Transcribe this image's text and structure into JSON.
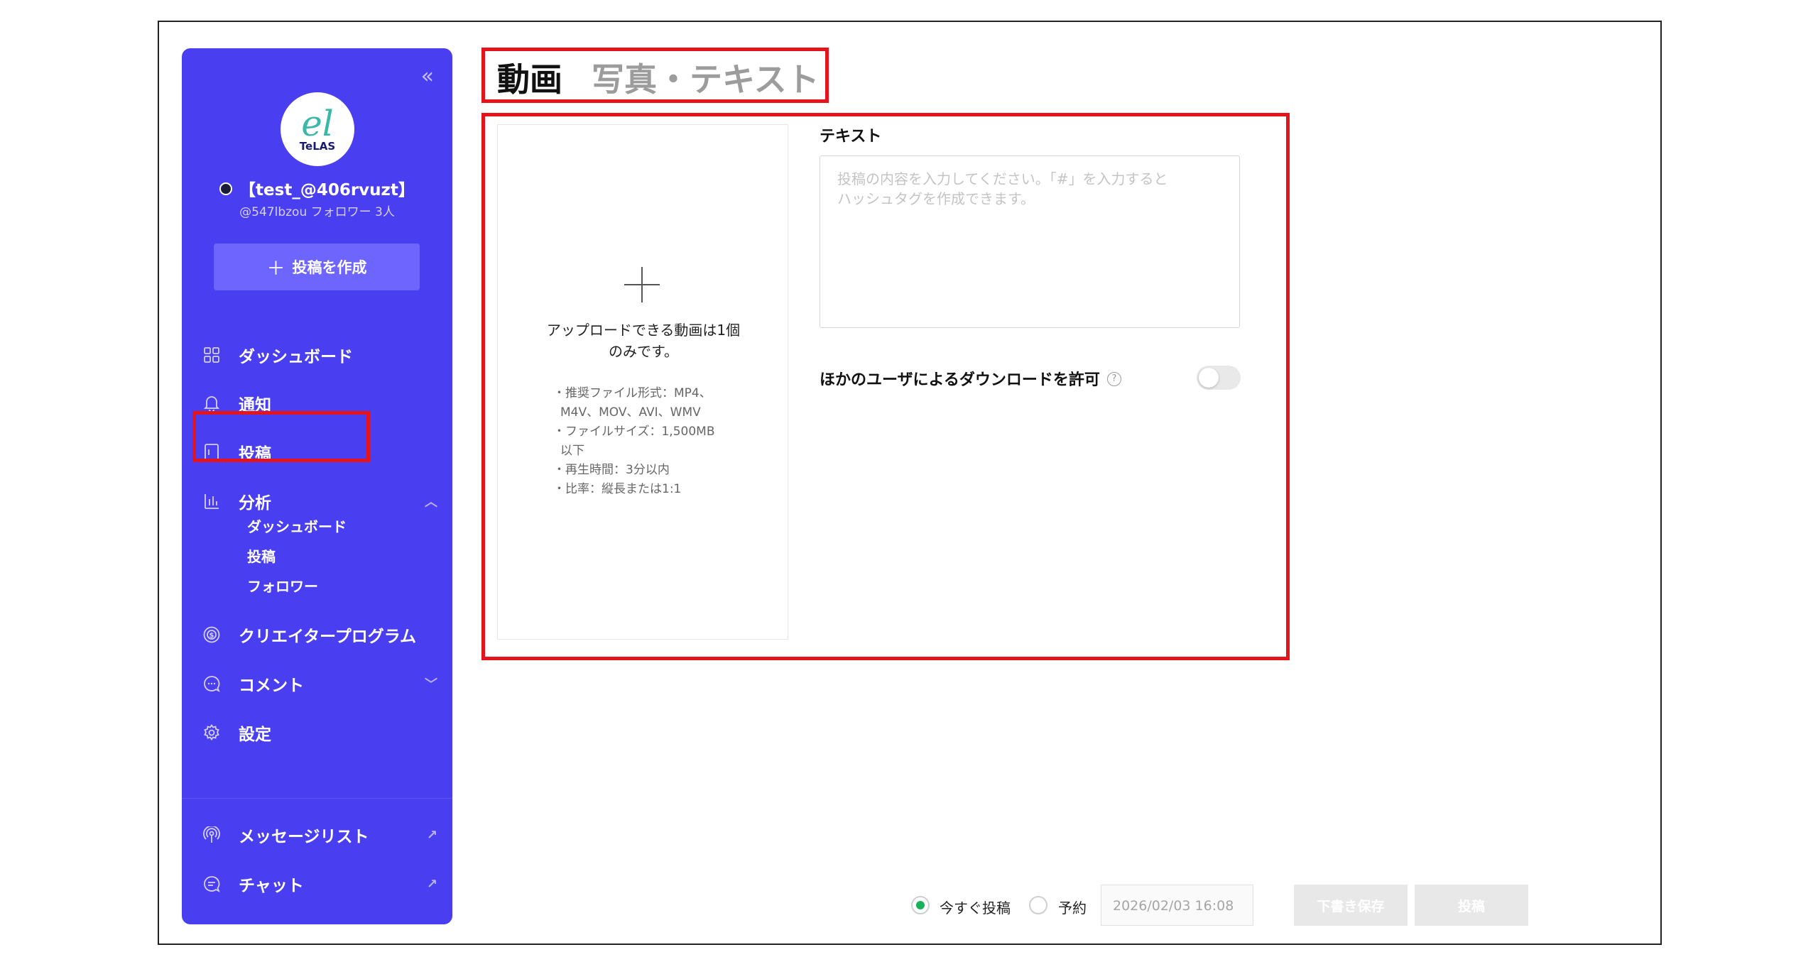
{
  "sidebar": {
    "collapse_icon": "«",
    "logo_mark": "el",
    "logo_text": "TeLAS",
    "profile_name": "【test_@406rvuzt】",
    "profile_sub": "@547lbzou  フォロワー 3人",
    "create_button": "投稿を作成",
    "nav": {
      "dashboard": "ダッシュボード",
      "notifications": "通知",
      "posts": "投稿",
      "analytics": "分析",
      "analytics_sub": [
        "ダッシュボード",
        "投稿",
        "フォロワー"
      ],
      "creator_program": "クリエイタープログラム",
      "comments": "コメント",
      "settings": "設定",
      "message_list": "メッセージリスト",
      "chat": "チャット"
    }
  },
  "header": {
    "tab_video": "動画",
    "tab_photo_text": "写真・テキスト"
  },
  "upload": {
    "title_line1": "アップロードできる動画は1個",
    "title_line2": "のみです。",
    "specs": [
      "・推奨ファイル形式：MP4、",
      "M4V、MOV、AVI、WMV",
      "・ファイルサイズ：1,500MB",
      "以下",
      "・再生時間：3分以内",
      "・比率：縦長または1:1"
    ]
  },
  "text_field": {
    "label": "テキスト",
    "placeholder_line1": "投稿の内容を入力してください。「#」を入力すると",
    "placeholder_line2": "ハッシュタグを作成できます。"
  },
  "download": {
    "label": "ほかのユーザによるダウンロードを許可",
    "help": "?",
    "enabled": false
  },
  "footer": {
    "now_label": "今すぐ投稿",
    "schedule_label": "予約",
    "datetime": "2026/02/03 16:08",
    "save_draft": "下書き保存",
    "post": "投稿"
  },
  "colors": {
    "sidebar_bg": "#4a3ff0",
    "accent_green": "#18b25a",
    "highlight_red": "#e5131b"
  }
}
